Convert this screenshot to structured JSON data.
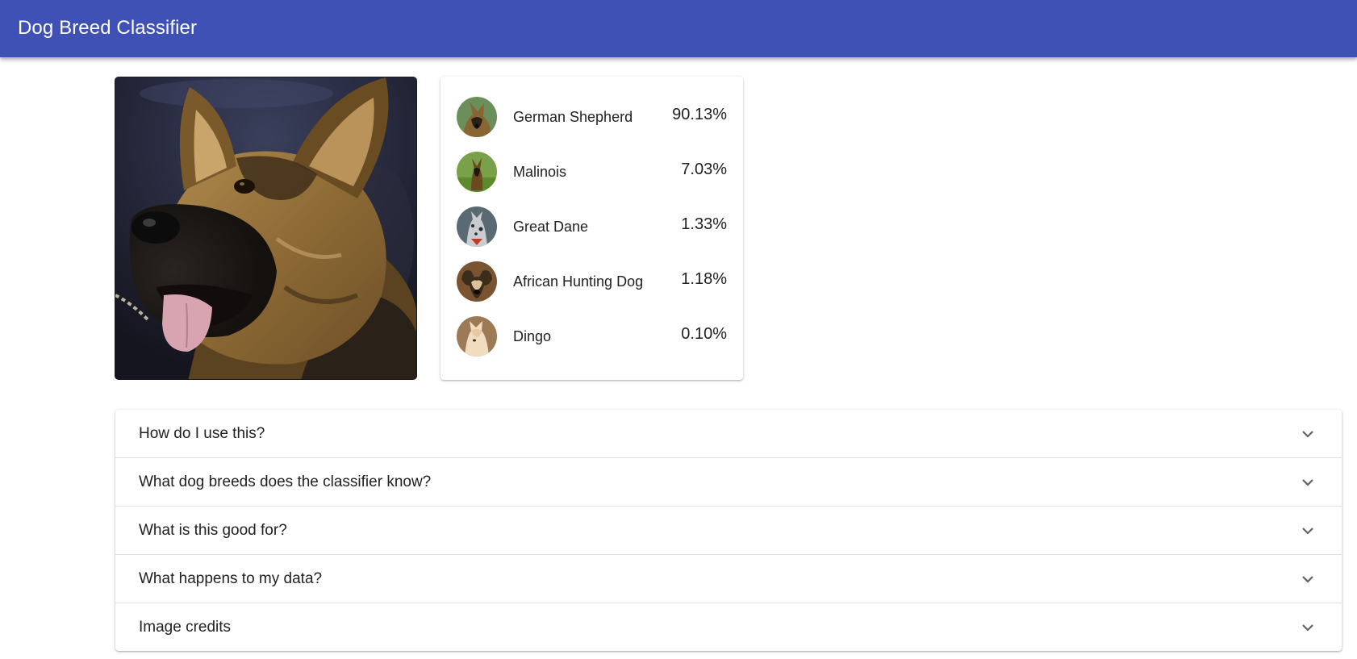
{
  "app": {
    "title": "Dog Breed Classifier"
  },
  "uploaded_image": {
    "subject": "german-shepherd-photo"
  },
  "predictions": [
    {
      "breed": "German Shepherd",
      "probability": "90.13%",
      "avatar": "german-shepherd-avatar"
    },
    {
      "breed": "Malinois",
      "probability": "7.03%",
      "avatar": "malinois-avatar"
    },
    {
      "breed": "Great Dane",
      "probability": "1.33%",
      "avatar": "great-dane-avatar"
    },
    {
      "breed": "African Hunting Dog",
      "probability": "1.18%",
      "avatar": "african-hunting-dog-avatar"
    },
    {
      "breed": "Dingo",
      "probability": "0.10%",
      "avatar": "dingo-avatar"
    }
  ],
  "faq": [
    {
      "question": "How do I use this?",
      "icon": "chevron-down-icon"
    },
    {
      "question": "What dog breeds does the classifier know?",
      "icon": "chevron-down-icon"
    },
    {
      "question": "What is this good for?",
      "icon": "chevron-down-icon"
    },
    {
      "question": "What happens to my data?",
      "icon": "chevron-down-icon"
    },
    {
      "question": "Image credits",
      "icon": "chevron-down-icon"
    }
  ],
  "colors": {
    "app_bar": "#3f51b5",
    "app_bar_text": "#ffffff",
    "text": "#212121",
    "divider": "#e0e0e0"
  }
}
